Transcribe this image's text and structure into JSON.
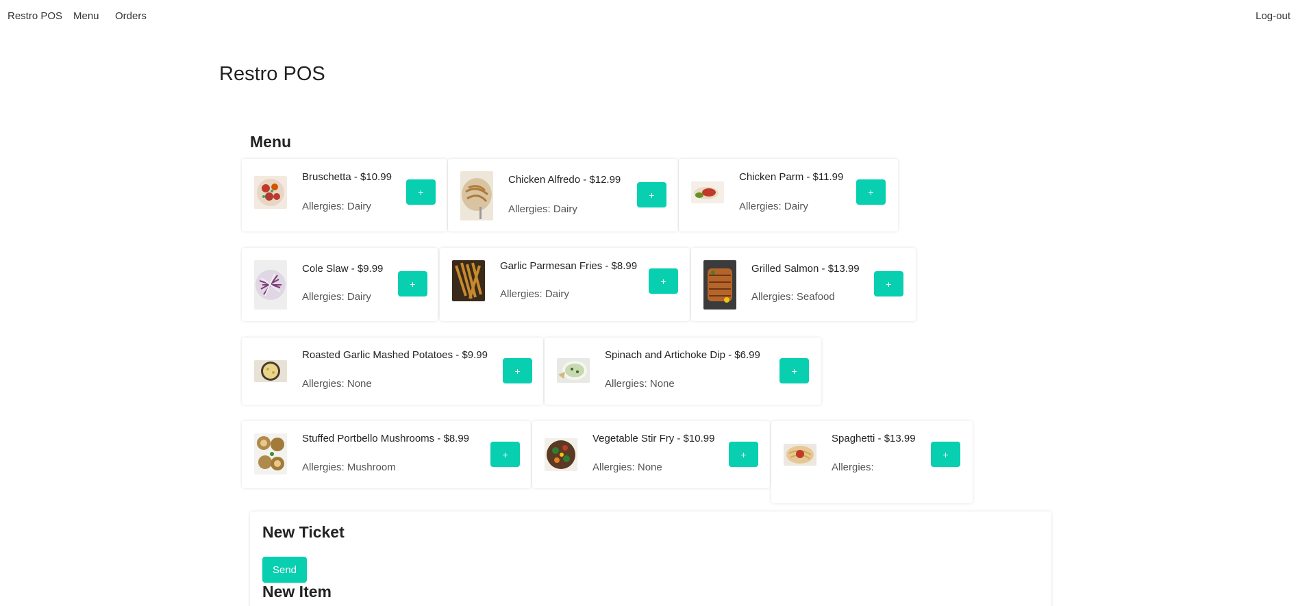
{
  "nav": {
    "brand": "Restro POS",
    "menu": "Menu",
    "orders": "Orders",
    "logout": "Log-out"
  },
  "page_title": "Restro POS",
  "menu_heading": "Menu",
  "add_label": "+",
  "menu_items": [
    {
      "title": "Bruschetta - $10.99",
      "allergy": "Allergies: Dairy",
      "image": "bruschetta-photo"
    },
    {
      "title": "Chicken Alfredo - $12.99",
      "allergy": "Allergies: Dairy",
      "image": "chicken-alfredo-photo"
    },
    {
      "title": "Chicken Parm - $11.99",
      "allergy": "Allergies: Dairy",
      "image": "chicken-parm-photo"
    },
    {
      "title": "Cole Slaw - $9.99",
      "allergy": "Allergies: Dairy",
      "image": "cole-slaw-photo"
    },
    {
      "title": "Garlic Parmesan Fries - $8.99",
      "allergy": "Allergies: Dairy",
      "image": "fries-photo"
    },
    {
      "title": "Grilled Salmon - $13.99",
      "allergy": "Allergies: Seafood",
      "image": "salmon-photo"
    },
    {
      "title": "Roasted Garlic Mashed Potatoes - $9.99",
      "allergy": "Allergies: None",
      "image": "mashed-potatoes-photo"
    },
    {
      "title": "Spinach and Artichoke Dip - $6.99",
      "allergy": "Allergies: None",
      "image": "spinach-dip-photo"
    },
    {
      "title": "Stuffed Portbello Mushrooms - $8.99",
      "allergy": "Allergies: Mushroom",
      "image": "mushrooms-photo"
    },
    {
      "title": "Vegetable Stir Fry - $10.99",
      "allergy": "Allergies: None",
      "image": "stir-fry-photo"
    },
    {
      "title": "Spaghetti - $13.99",
      "allergy": "Allergies:",
      "image": "spaghetti-photo"
    }
  ],
  "ticket": {
    "title": "New Ticket",
    "send_label": "Send",
    "new_item_title": "New Item"
  },
  "colors": {
    "accent": "#08cfb0"
  }
}
